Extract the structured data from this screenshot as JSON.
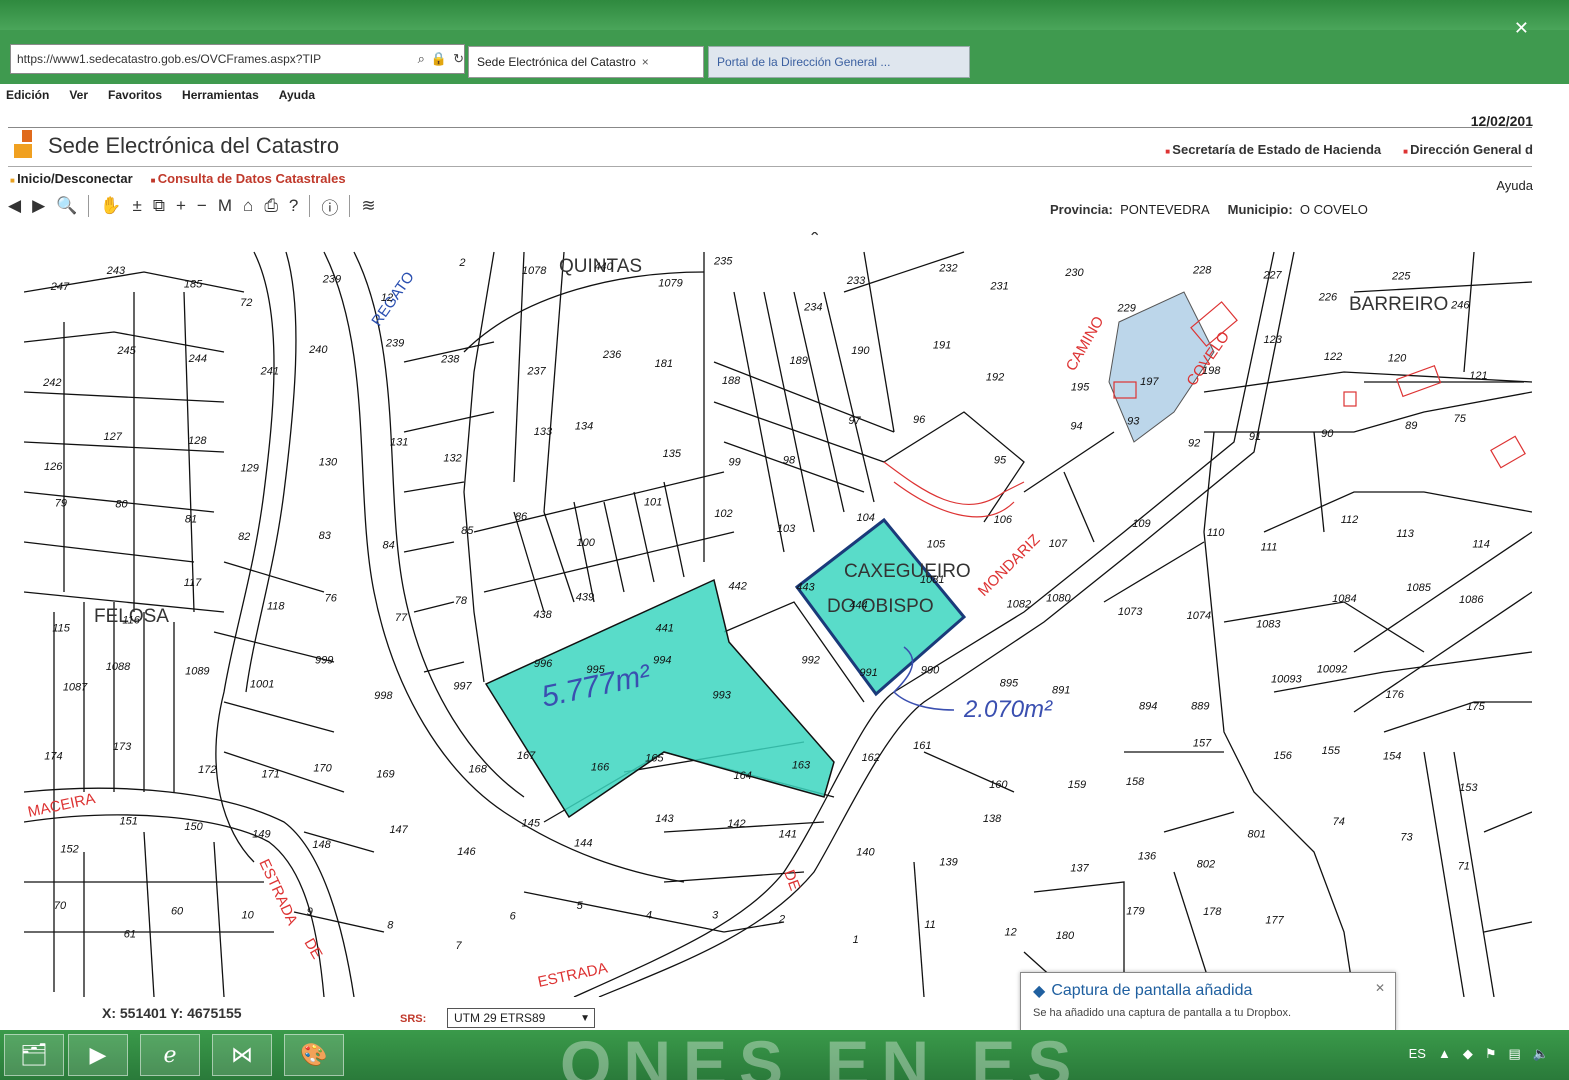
{
  "browser": {
    "url": "https://www1.sedecatastro.gob.es/OVCFrames.aspx?TIP",
    "tabs": [
      {
        "label": "Sede Electrónica del Catastro",
        "close": "×"
      },
      {
        "label": "Portal de la Dirección General ..."
      }
    ],
    "menu": [
      "Edición",
      "Ver",
      "Favoritos",
      "Herramientas",
      "Ayuda"
    ]
  },
  "header": {
    "date": "12/02/201",
    "site_title": "Sede Electrónica del Catastro",
    "ministry_links": [
      "Secretaría de Estado de Hacienda",
      "Dirección General d"
    ],
    "nav": [
      "Inicio/Desconectar",
      "Consulta de Datos Catastrales"
    ],
    "help": "Ayuda"
  },
  "location": {
    "province_label": "Provincia:",
    "province": "PONTEVEDRA",
    "municipality_label": "Municipio:",
    "municipality": "O COVELO"
  },
  "map": {
    "place_names": [
      "BARREIRO",
      "FELOSA",
      "QUINTAS",
      "CAXEGUEIRO",
      "DO OBISPO"
    ],
    "road_names": [
      "REGATO",
      "MONDARIZ",
      "MACEIRA",
      "ESTRADA",
      "ESTRADA",
      "DE",
      "DE",
      "COVELO",
      "CAMINO"
    ],
    "annotations": {
      "area_left": "5.777m²",
      "area_right": "2.070m²"
    },
    "highlight_color": "#3cd6c0",
    "parcel_numbers": [
      "247",
      "243",
      "185",
      "72",
      "239",
      "12",
      "2",
      "1078",
      "440",
      "1079",
      "235",
      "234",
      "233",
      "232",
      "231",
      "230",
      "229",
      "228",
      "227",
      "226",
      "225",
      "246",
      "242",
      "245",
      "244",
      "241",
      "240",
      "239",
      "238",
      "237",
      "236",
      "181",
      "188",
      "189",
      "190",
      "191",
      "192",
      "195",
      "197",
      "198",
      "123",
      "122",
      "120",
      "121",
      "126",
      "127",
      "128",
      "129",
      "130",
      "131",
      "132",
      "133",
      "134",
      "135",
      "99",
      "98",
      "97",
      "96",
      "95",
      "94",
      "93",
      "92",
      "91",
      "90",
      "89",
      "75",
      "79",
      "80",
      "81",
      "82",
      "83",
      "84",
      "85",
      "86",
      "100",
      "101",
      "102",
      "103",
      "104",
      "105",
      "106",
      "107",
      "109",
      "110",
      "111",
      "112",
      "113",
      "114",
      "115",
      "116",
      "117",
      "118",
      "76",
      "77",
      "78",
      "438",
      "439",
      "441",
      "442",
      "443",
      "444",
      "1081",
      "1082",
      "1080",
      "1073",
      "1074",
      "1083",
      "1084",
      "1085",
      "1086",
      "1087",
      "1088",
      "1089",
      "1001",
      "999",
      "998",
      "997",
      "996",
      "995",
      "994",
      "993",
      "992",
      "991",
      "990",
      "895",
      "891",
      "894",
      "889",
      "10093",
      "10092",
      "176",
      "175",
      "174",
      "173",
      "172",
      "171",
      "170",
      "169",
      "168",
      "167",
      "166",
      "165",
      "164",
      "163",
      "162",
      "161",
      "160",
      "159",
      "158",
      "157",
      "156",
      "155",
      "154",
      "153",
      "152",
      "151",
      "150",
      "149",
      "148",
      "147",
      "146",
      "145",
      "144",
      "143",
      "142",
      "141",
      "140",
      "139",
      "138",
      "137",
      "136",
      "802",
      "801",
      "74",
      "73",
      "71",
      "70",
      "61",
      "60",
      "10",
      "9",
      "8",
      "7",
      "6",
      "5",
      "4",
      "3",
      "2",
      "1",
      "11",
      "12",
      "180",
      "179",
      "178",
      "177"
    ],
    "hidden_note": ""
  },
  "status": {
    "coords": "X: 551401 Y: 4675155",
    "srs_label": "SRS:",
    "srs_value": "UTM 29 ETRS89"
  },
  "toast": {
    "title": "Captura de pantalla añadida",
    "body": "Se ha añadido una captura de pantalla a tu Dropbox."
  },
  "taskbar": {
    "tray_lang": "ES",
    "watermark": "ONES EN ES"
  }
}
